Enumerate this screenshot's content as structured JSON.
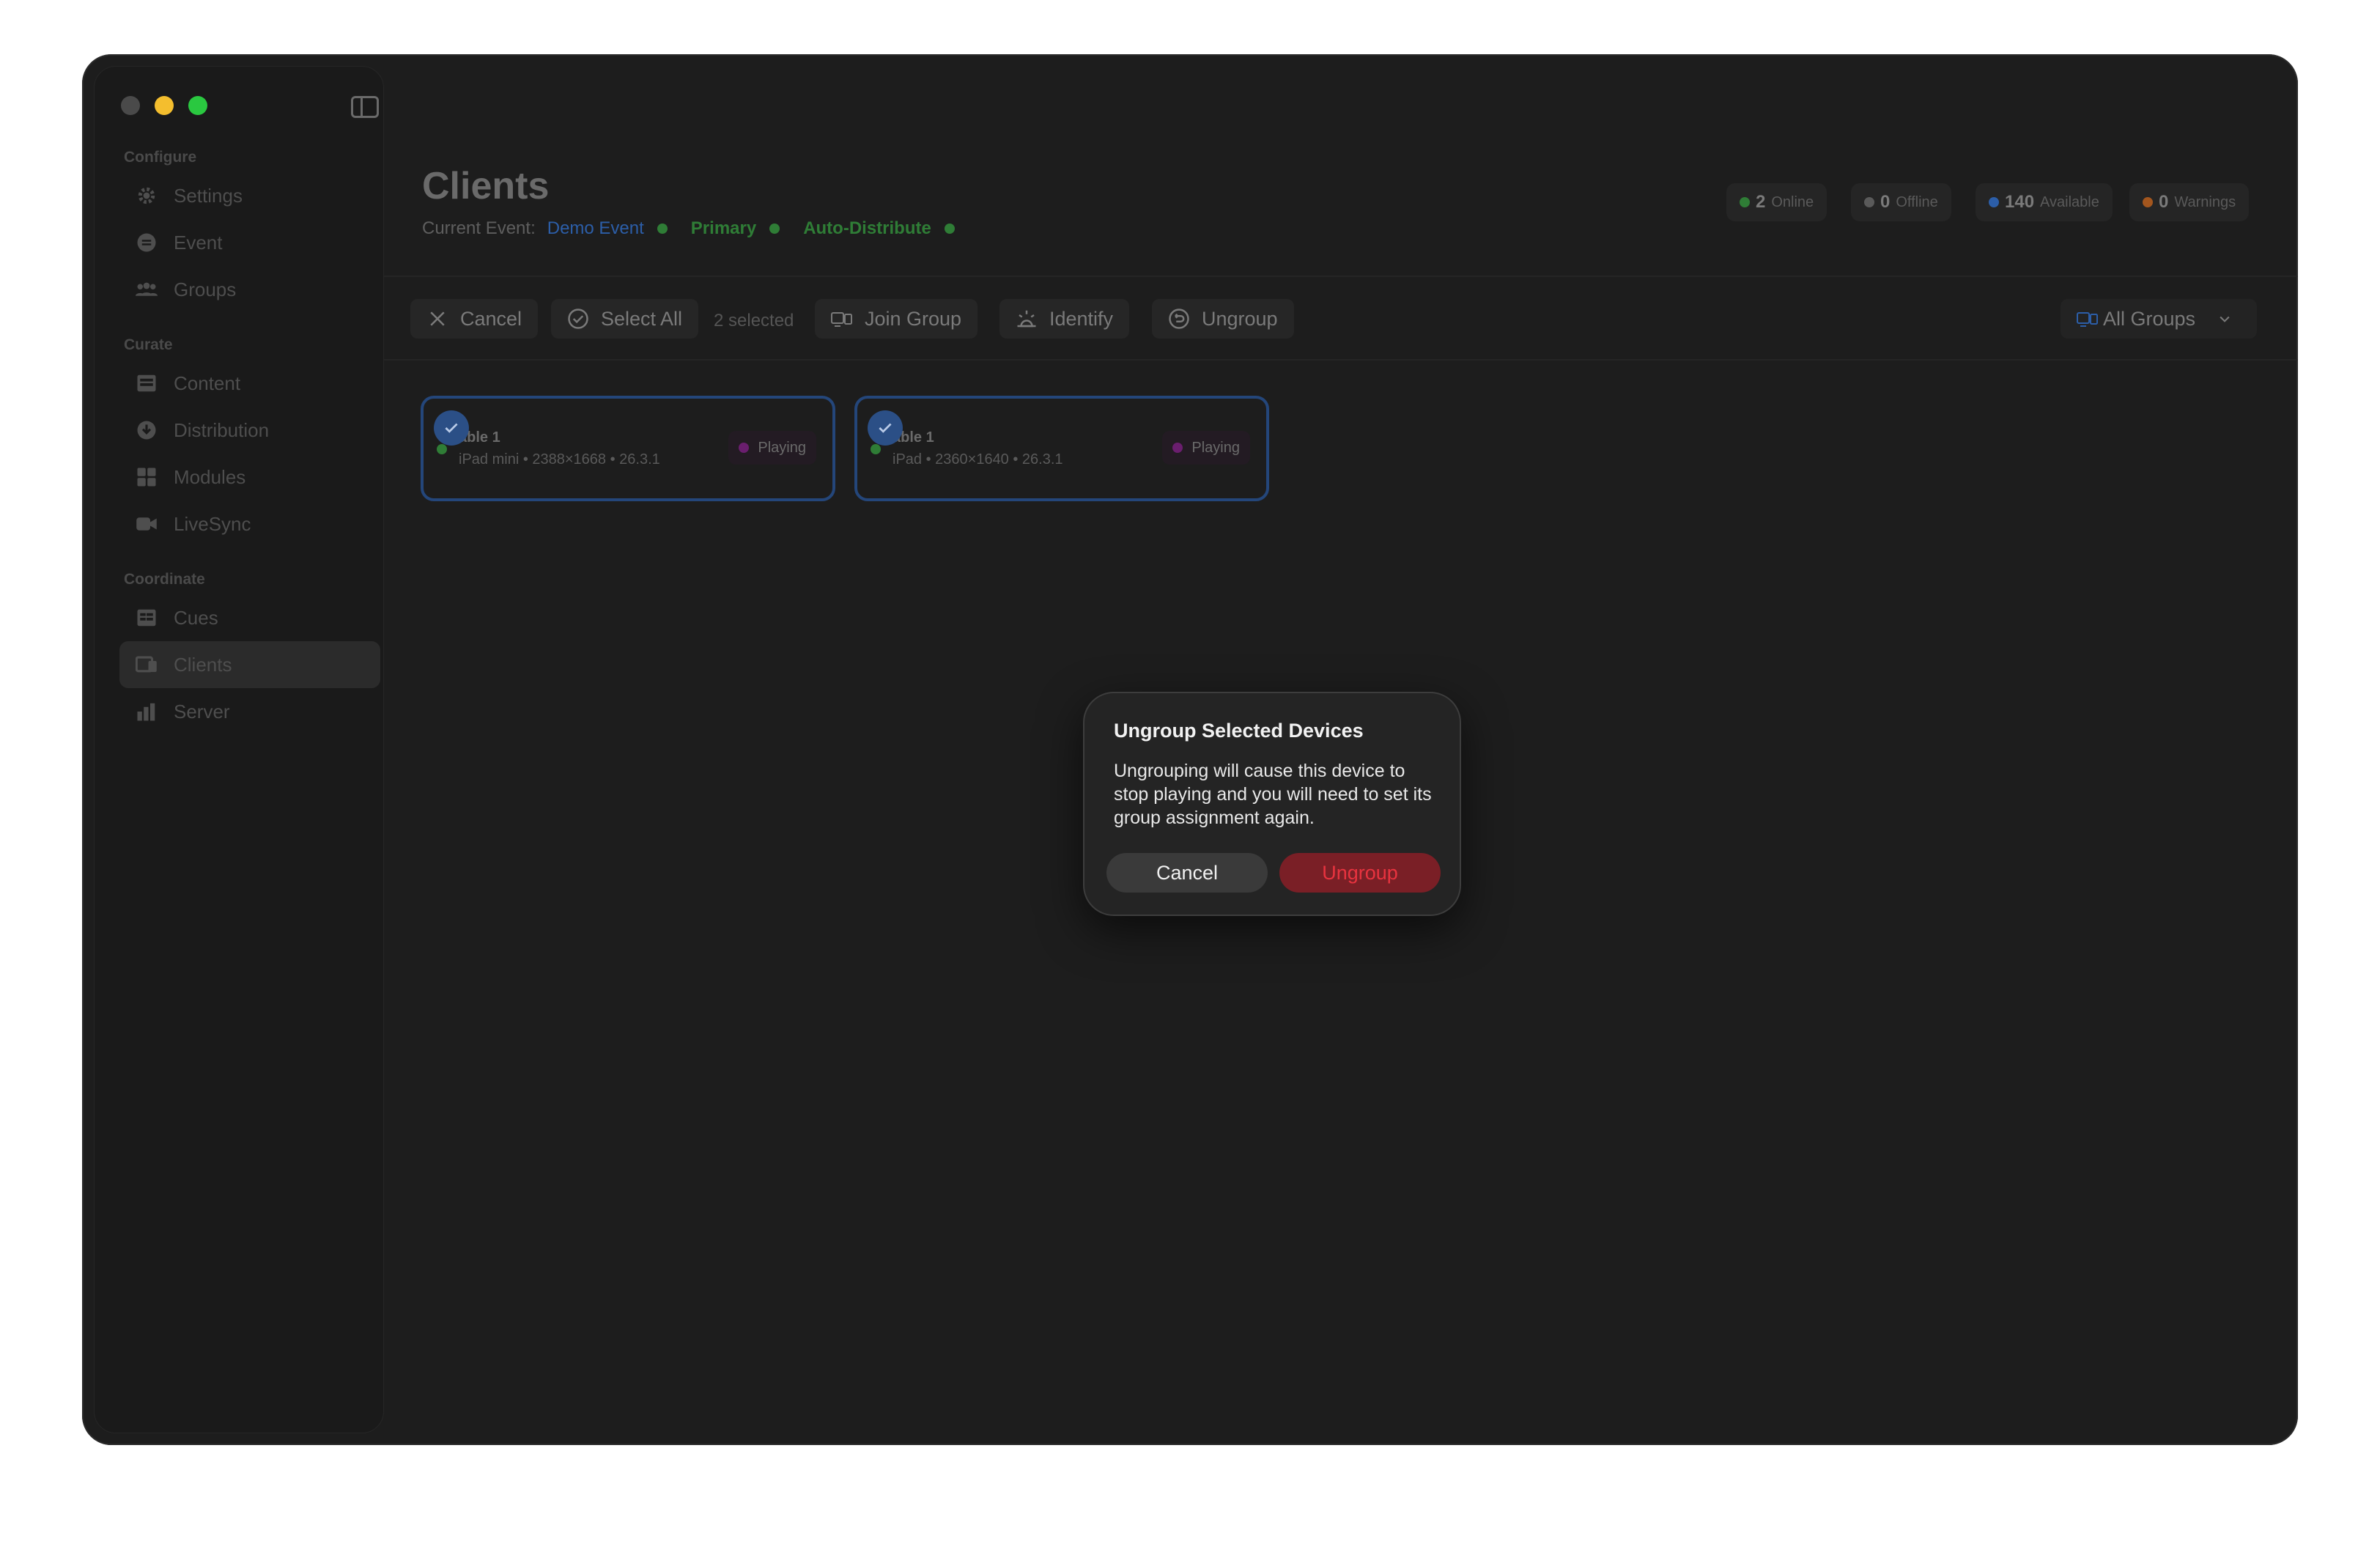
{
  "sidebar": {
    "sections": [
      {
        "label": "Configure",
        "items": [
          {
            "label": "Settings",
            "icon": "gear-icon"
          },
          {
            "label": "Event",
            "icon": "event-icon"
          },
          {
            "label": "Groups",
            "icon": "people-icon"
          }
        ]
      },
      {
        "label": "Curate",
        "items": [
          {
            "label": "Content",
            "icon": "content-icon"
          },
          {
            "label": "Distribution",
            "icon": "download-icon"
          },
          {
            "label": "Modules",
            "icon": "grid-icon"
          },
          {
            "label": "LiveSync",
            "icon": "video-icon"
          }
        ]
      },
      {
        "label": "Coordinate",
        "items": [
          {
            "label": "Cues",
            "icon": "cues-icon"
          },
          {
            "label": "Clients",
            "icon": "clients-icon",
            "active": true
          },
          {
            "label": "Server",
            "icon": "chart-icon"
          }
        ]
      }
    ]
  },
  "header": {
    "title": "Clients",
    "current_event_label": "Current Event:",
    "event_name": "Demo Event",
    "primary": "Primary",
    "auto_distribute": "Auto-Distribute",
    "stats": [
      {
        "count": "2",
        "label": "Online",
        "color": "#2f7d36"
      },
      {
        "count": "0",
        "label": "Offline",
        "color": "#5a5a5a"
      },
      {
        "count": "140",
        "label": "Available",
        "color": "#2c5ea8"
      },
      {
        "count": "0",
        "label": "Warnings",
        "color": "#a3561e"
      }
    ]
  },
  "toolbar": {
    "cancel": "Cancel",
    "select_all": "Select All",
    "selected_count": "2 selected",
    "join_group": "Join Group",
    "identify": "Identify",
    "ungroup": "Ungroup",
    "group_filter": "All Groups"
  },
  "devices": [
    {
      "name": "Table 1",
      "name_visible": "able 1",
      "spec": "iPad mini • 2388×1668 • 26.3.1",
      "status": "Playing"
    },
    {
      "name": "Table 1",
      "name_visible": "able 1",
      "spec": "iPad • 2360×1640 • 26.3.1",
      "status": "Playing"
    }
  ],
  "dialog": {
    "title": "Ungroup Selected Devices",
    "message": "Ungrouping will cause this device to stop playing and you will need to set its group assignment again.",
    "cancel": "Cancel",
    "confirm": "Ungroup"
  },
  "colors": {
    "accent_blue": "#2c5ea8",
    "online_green": "#2f7d36",
    "destructive_red": "#e8333f",
    "destructive_bg": "#7a1f26"
  }
}
